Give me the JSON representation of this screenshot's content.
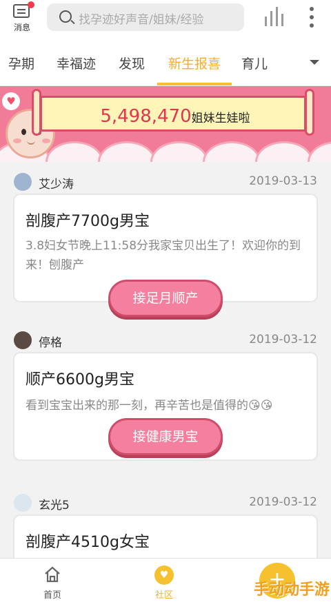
{
  "topbar": {
    "message_label": "消息",
    "search_placeholder": "找孕迹好声音/姐妹/经验"
  },
  "tabs": [
    {
      "label": "孕期",
      "active": false
    },
    {
      "label": "幸福迹",
      "active": false
    },
    {
      "label": "发现",
      "active": false
    },
    {
      "label": "新生报喜",
      "active": true
    },
    {
      "label": "育儿",
      "active": false
    }
  ],
  "banner": {
    "count": "5,498,470",
    "suffix": "姐妹生娃啦"
  },
  "posts": [
    {
      "author": "艾少涛",
      "date": "2019-03-13",
      "title": "剖腹产7700g男宝",
      "body": "3.8妇女节晚上11:58分我家宝贝出生了！欢迎你的到来！刨腹产",
      "cta": "接足月顺产"
    },
    {
      "author": "停格",
      "date": "2019-03-12",
      "title": " 顺产6600g男宝",
      "body": "看到宝宝出来的那一刻，再辛苦也是值得的😘😘",
      "cta": "接健康男宝"
    },
    {
      "author": "玄光5",
      "date": "2019-03-12",
      "title": "剖腹产4510g女宝",
      "body": "",
      "cta": ""
    }
  ],
  "bottomnav": {
    "home_label": "首页",
    "community_label": "社区",
    "fab_symbol": "+"
  },
  "watermark": "手动动手游",
  "colors": {
    "accent": "#f6c12e",
    "banner_pink": "#f27b97",
    "count_red": "#e0344f",
    "button_pink": "#f47f9e"
  }
}
